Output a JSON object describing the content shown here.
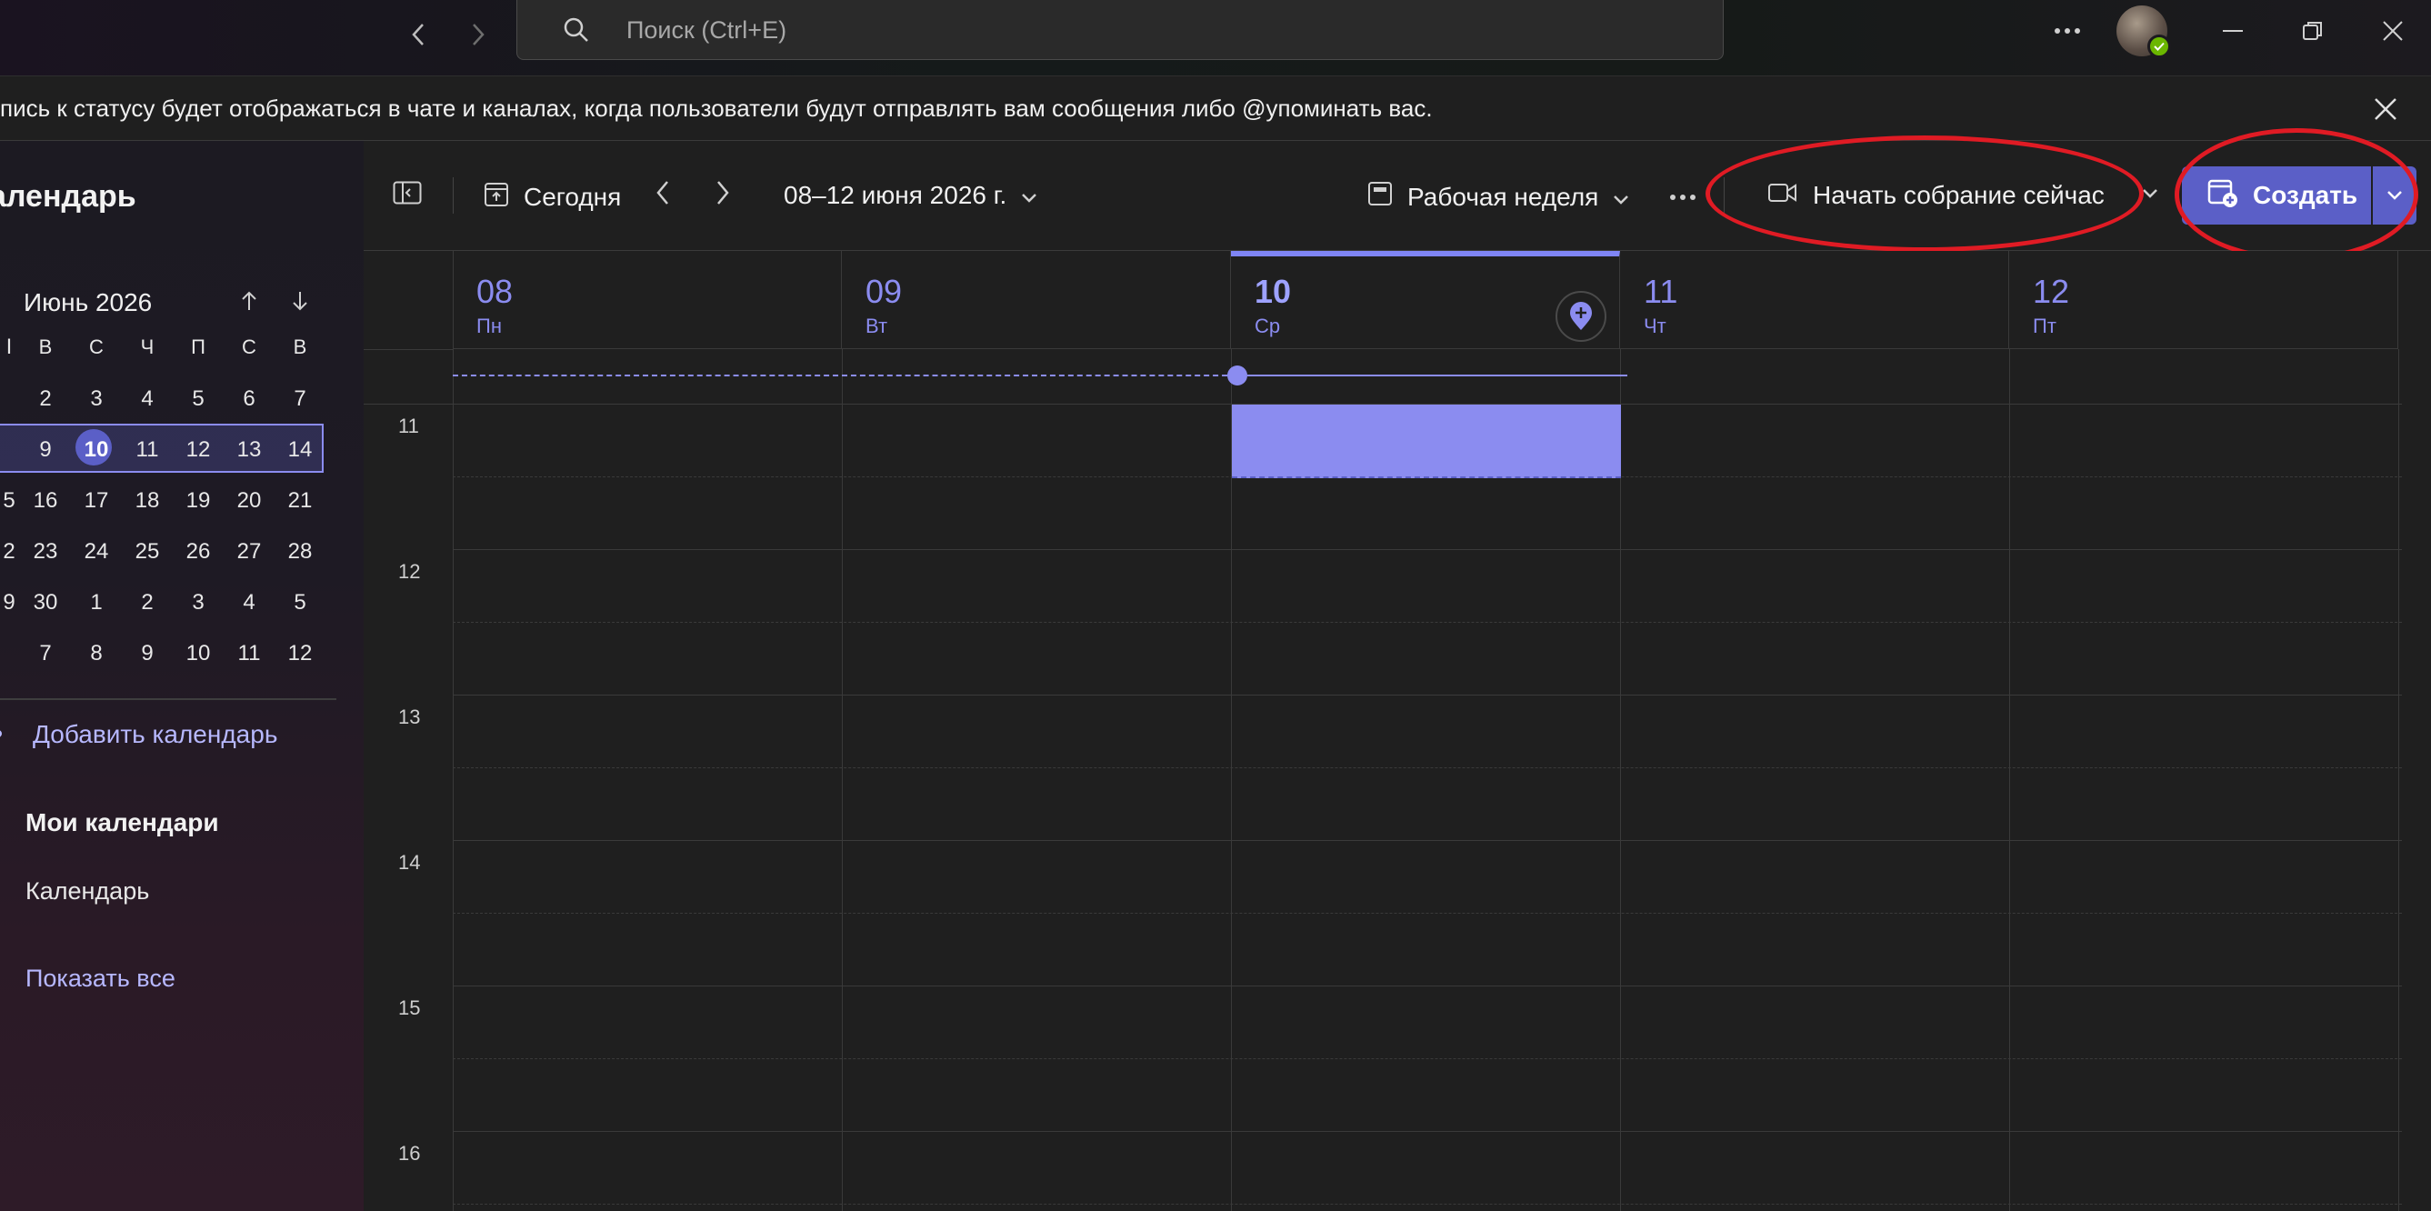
{
  "titlebar": {
    "search_placeholder": "Поиск (Ctrl+E)",
    "icons": [
      "back-icon",
      "forward-icon",
      "search-icon",
      "more-icon",
      "minimize-icon",
      "restore-icon",
      "close-icon"
    ],
    "presence_color": "#6bb700"
  },
  "banner": {
    "message": "пись к статусу будет отображаться в чате и каналах, когда пользователи будут отправлять вам сообщения либо @упоминать вас."
  },
  "sidebar": {
    "title": "алендарь",
    "month_label": "Июнь 2026",
    "weekday_headers": [
      "Ⅰ",
      "В",
      "С",
      "Ч",
      "П",
      "С",
      "В"
    ],
    "weeks": [
      [
        "",
        "2",
        "3",
        "4",
        "5",
        "6",
        "7"
      ],
      [
        "",
        "9",
        "10",
        "11",
        "12",
        "13",
        "14"
      ],
      [
        "5",
        "16",
        "17",
        "18",
        "19",
        "20",
        "21"
      ],
      [
        "2",
        "23",
        "24",
        "25",
        "26",
        "27",
        "28"
      ],
      [
        "9",
        "30",
        "1",
        "2",
        "3",
        "4",
        "5"
      ],
      [
        "",
        "7",
        "8",
        "9",
        "10",
        "11",
        "12"
      ]
    ],
    "selected_day": "10",
    "add_calendar": "Добавить календарь",
    "my_calendars": "Мои календари",
    "calendar_item": "Календарь",
    "show_all": "Показать все"
  },
  "toolbar": {
    "today": "Сегодня",
    "date_range": "08–12 июня 2026 г.",
    "view": "Рабочая неделя",
    "meet_now": "Начать собрание сейчас",
    "create": "Создать"
  },
  "calendar": {
    "days": [
      {
        "num": "08",
        "weekday": "Пн",
        "today": false
      },
      {
        "num": "09",
        "weekday": "Вт",
        "today": false
      },
      {
        "num": "10",
        "weekday": "Ср",
        "today": true
      },
      {
        "num": "11",
        "weekday": "Чт",
        "today": false
      },
      {
        "num": "12",
        "weekday": "Пт",
        "today": false
      }
    ],
    "hours": [
      "11",
      "12",
      "13",
      "14",
      "15",
      "16"
    ]
  },
  "colors": {
    "accent": "#5b5fc7",
    "accent_light": "#8b8cf0",
    "annotation": "#e01b24"
  }
}
